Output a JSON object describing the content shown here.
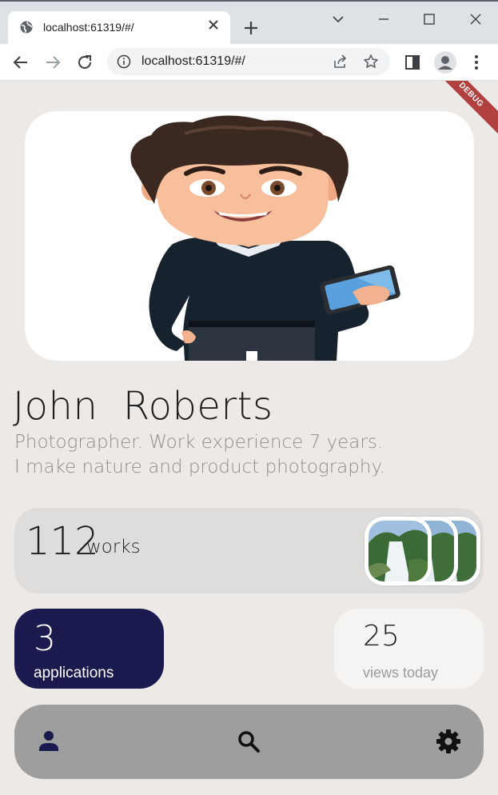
{
  "browser": {
    "tab_title": "localhost:61319/#/",
    "url": "localhost:61319/#/"
  },
  "app": {
    "debug_banner": "DEBUG",
    "profile": {
      "name": "John  Roberts",
      "bio_line1": "Photographer. Work experience 7 years.",
      "bio_line2": "I make nature and product photography."
    },
    "works": {
      "count": "112",
      "label": "works",
      "thumbnail_count": 3
    },
    "applications": {
      "count": "3",
      "label": "applications"
    },
    "views": {
      "count": "25",
      "label": "views today"
    },
    "nav": {
      "items": [
        {
          "name": "profile",
          "icon": "person-icon",
          "selected": true
        },
        {
          "name": "search",
          "icon": "search-icon",
          "selected": false
        },
        {
          "name": "settings",
          "icon": "gear-icon",
          "selected": false
        }
      ]
    },
    "colors": {
      "background": "#ede9e6",
      "accent_navy": "#1a1a4e",
      "card_light": "#f6f4f2",
      "card_grey": "#dedddc",
      "navbar_grey": "#9e9e9e",
      "debug_red": "#b0413e"
    }
  }
}
